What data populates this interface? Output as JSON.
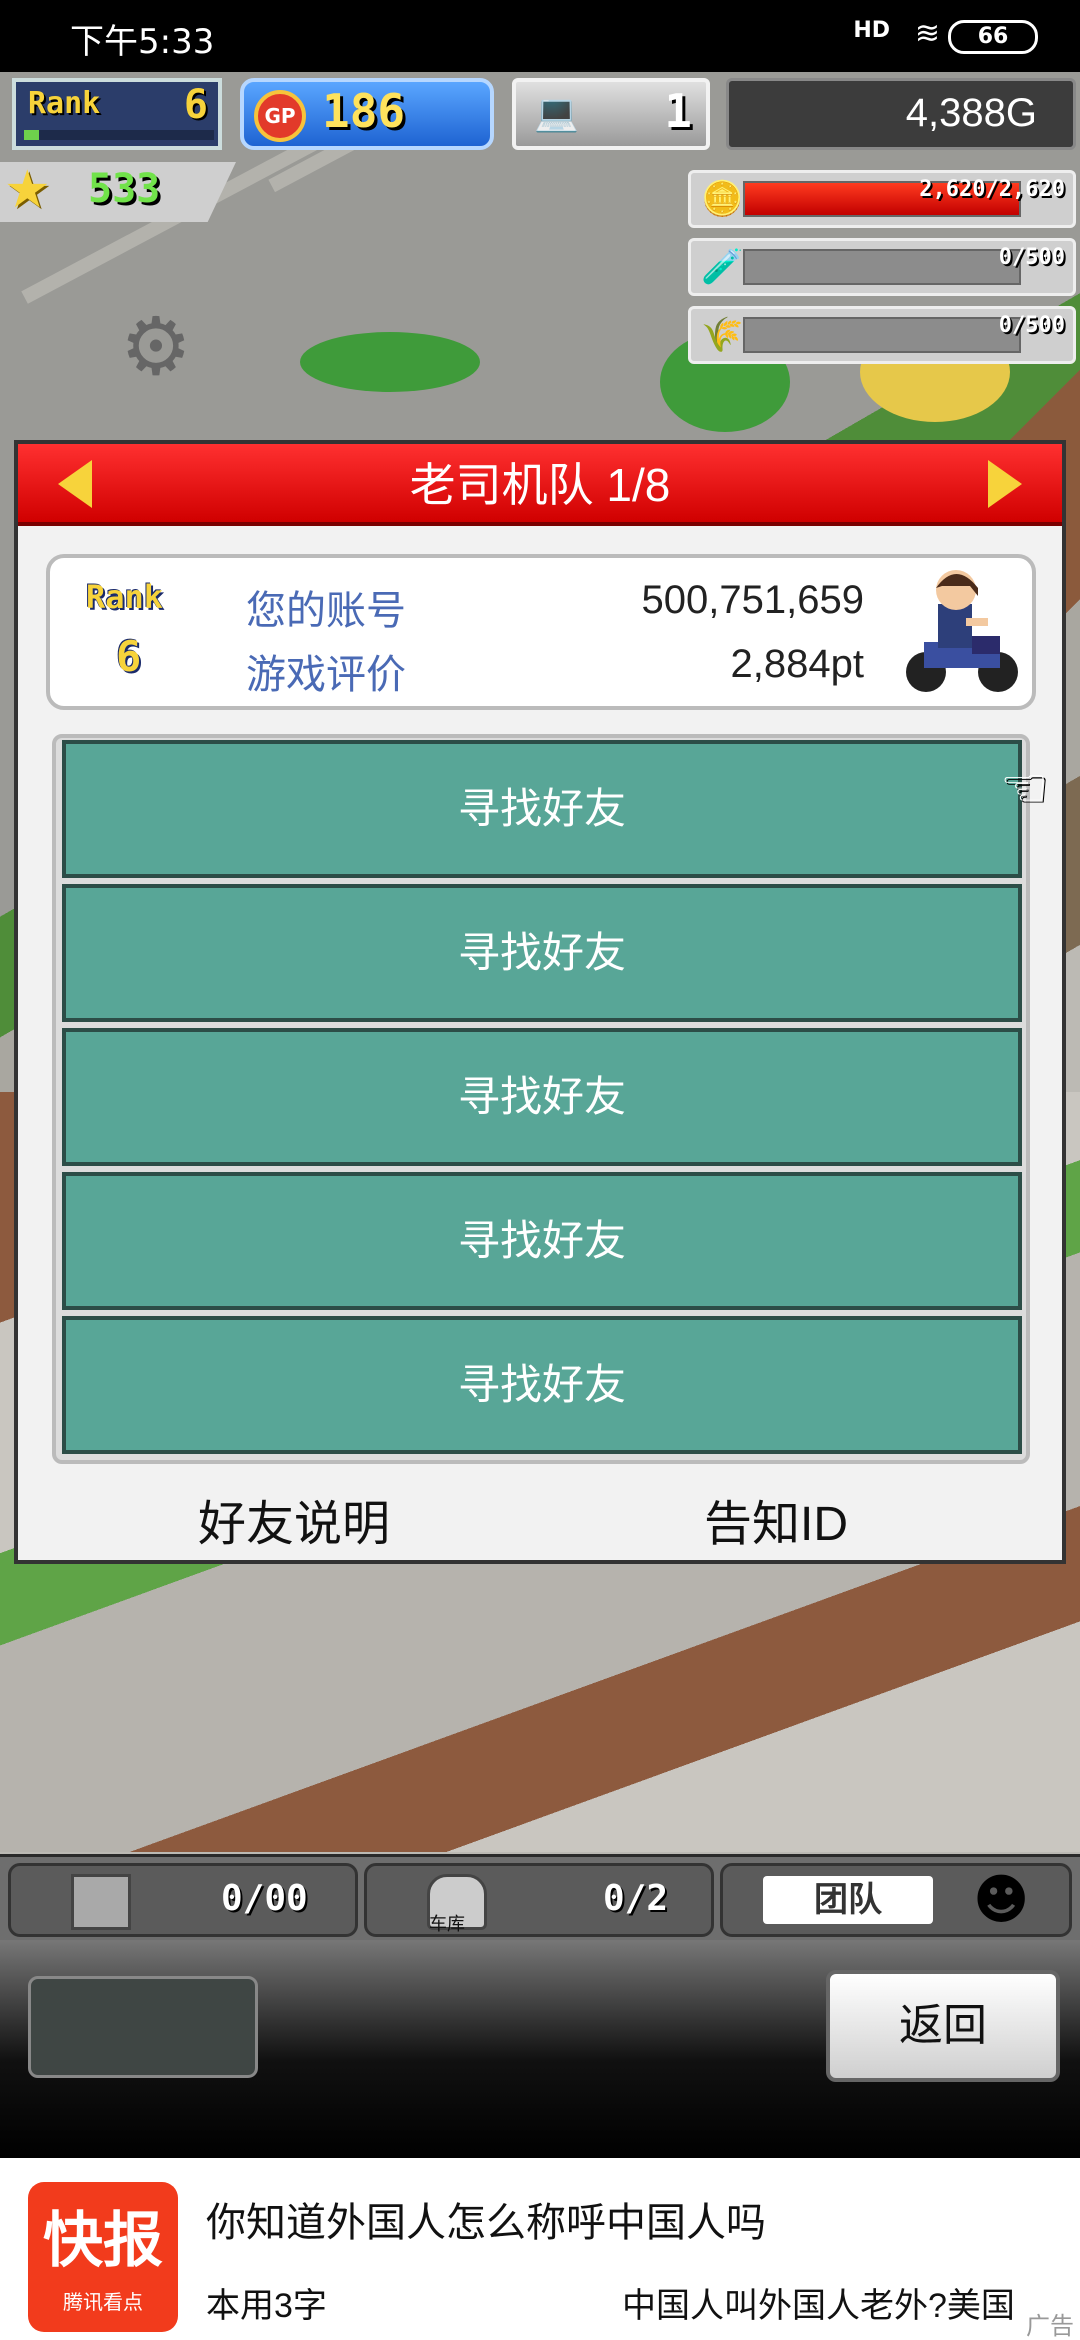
{
  "status_bar": {
    "time": "下午5:33",
    "signal": "HD",
    "wifi_icon": "wifi-icon",
    "battery": "66"
  },
  "hud": {
    "rank_label": "Rank",
    "rank_value": "6",
    "rank_progress": 0.08,
    "gp_label": "GP",
    "gp_value": "186",
    "pc_icon": "computer-icon",
    "pc_value": "1",
    "money": "4,388G",
    "star_value": "533",
    "resources": [
      {
        "icon": "coins-icon",
        "text": "2,620/2,620",
        "fraction": 1.0,
        "fill_color": "#e01010"
      },
      {
        "icon": "fuel-icon",
        "text": "0/500",
        "fraction": 0,
        "fill_color": "#e01010"
      },
      {
        "icon": "wheat-icon",
        "text": "0/500",
        "fraction": 0,
        "fill_color": "#e01010"
      }
    ]
  },
  "dialog": {
    "title": "老司机队 1/8",
    "rank_label": "Rank",
    "rank_value": "6",
    "account_label": "您的账号",
    "account_value": "500,751,659",
    "rating_label": "游戏评价",
    "rating_value": "2,884pt",
    "avatar_icon": "motorcycle-driver-icon",
    "friends": [
      {
        "label": "寻找好友"
      },
      {
        "label": "寻找好友"
      },
      {
        "label": "寻找好友"
      },
      {
        "label": "寻找好友"
      },
      {
        "label": "寻找好友"
      }
    ],
    "footer_left": "好友说明",
    "footer_right": "告知ID"
  },
  "bottom_tabs": {
    "storage_value": "0/00",
    "garage_value": "0/2",
    "garage_label": "车库",
    "team_label": "团队"
  },
  "bottom_panel": {
    "back_label": "返回"
  },
  "ad": {
    "logo_big": "快报",
    "logo_small": "腾讯看点",
    "title": "你知道外国人怎么称呼中国人吗",
    "left_text": "本用3字",
    "right_text": "中国人叫外国人老外?美国",
    "tag": "广告"
  },
  "colors": {
    "header_red": "#e01010",
    "friend_row": "#58a697",
    "account_label": "#4a6ab5",
    "gold": "#f7d33b"
  }
}
